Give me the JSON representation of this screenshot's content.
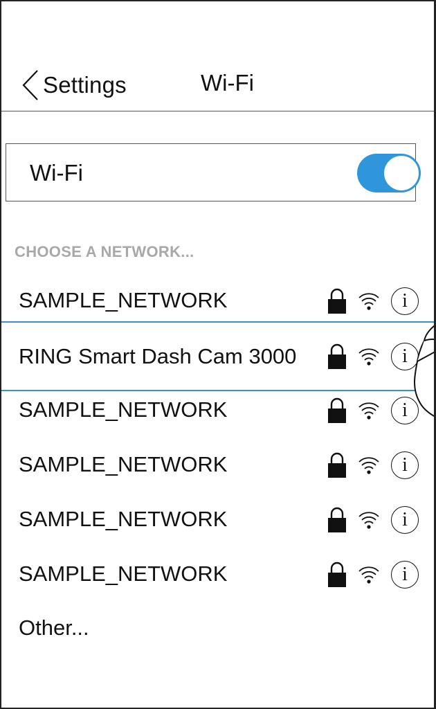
{
  "nav": {
    "back_label": "Settings",
    "title": "Wi-Fi"
  },
  "wifi_toggle": {
    "label": "Wi-Fi",
    "state": "on",
    "color": "#2f96dc"
  },
  "section_header": "CHOOSE A NETWORK...",
  "networks": [
    {
      "name": "SAMPLE_NETWORK"
    },
    {
      "name": "RING Smart Dash Cam 3000",
      "selected": true
    },
    {
      "name": "SAMPLE_NETWORK"
    },
    {
      "name": "SAMPLE_NETWORK"
    },
    {
      "name": "SAMPLE_NETWORK"
    },
    {
      "name": "SAMPLE_NETWORK"
    }
  ],
  "network_icons": {
    "security": "lock-icon",
    "signal": "wifi-signal-icon",
    "details": "info-icon",
    "details_glyph": "i"
  },
  "other_label": "Other..."
}
